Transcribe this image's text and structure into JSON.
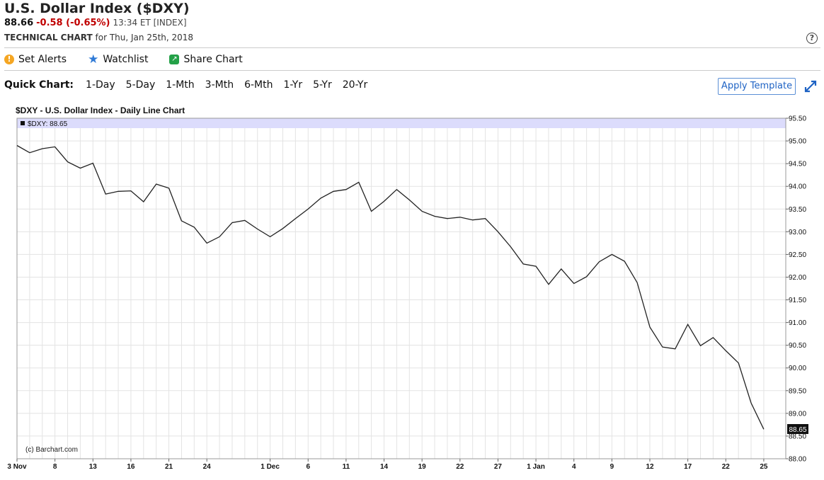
{
  "header": {
    "title": "U.S. Dollar Index ($DXY)",
    "last": "88.66",
    "change": "-0.58 (-0.65%)",
    "time": "13:34 ET [INDEX]",
    "chart_kind": "TECHNICAL CHART",
    "chart_date": "for Thu, Jan 25th, 2018",
    "help": "?"
  },
  "toolbar": {
    "alerts": "Set Alerts",
    "watchlist": "Watchlist",
    "share": "Share Chart",
    "alerts_icon": "!",
    "share_icon": "↗"
  },
  "quick": {
    "label": "Quick Chart:",
    "periods": [
      "1-Day",
      "5-Day",
      "1-Mth",
      "3-Mth",
      "6-Mth",
      "1-Yr",
      "5-Yr",
      "20-Yr"
    ],
    "apply": "Apply Template"
  },
  "chart_data": {
    "type": "line",
    "title": "$DXY - U.S. Dollar Index - Daily Line Chart",
    "legend": "$DXY: 88.65",
    "last_label": "88.65",
    "watermark": "(c) Barchart.com",
    "ylim": [
      88.0,
      95.5
    ],
    "y_ticks": [
      "88.00",
      "88.50",
      "89.00",
      "89.50",
      "90.00",
      "90.50",
      "91.00",
      "91.50",
      "92.00",
      "92.50",
      "93.00",
      "93.50",
      "94.00",
      "94.50",
      "95.00",
      "95.50"
    ],
    "x_labels": [
      {
        "i": 0,
        "t": "3 Nov"
      },
      {
        "i": 3,
        "t": "8"
      },
      {
        "i": 6,
        "t": "13"
      },
      {
        "i": 9,
        "t": "16"
      },
      {
        "i": 12,
        "t": "21"
      },
      {
        "i": 15,
        "t": "24"
      },
      {
        "i": 20,
        "t": "1 Dec"
      },
      {
        "i": 23,
        "t": "6"
      },
      {
        "i": 26,
        "t": "11"
      },
      {
        "i": 29,
        "t": "14"
      },
      {
        "i": 32,
        "t": "19"
      },
      {
        "i": 35,
        "t": "22"
      },
      {
        "i": 38,
        "t": "27"
      },
      {
        "i": 41,
        "t": "1 Jan"
      },
      {
        "i": 44,
        "t": "4"
      },
      {
        "i": 47,
        "t": "9"
      },
      {
        "i": 50,
        "t": "12"
      },
      {
        "i": 53,
        "t": "17"
      },
      {
        "i": 56,
        "t": "22"
      },
      {
        "i": 59,
        "t": "25"
      }
    ],
    "values": [
      94.9,
      94.74,
      94.83,
      94.87,
      94.54,
      94.4,
      94.51,
      93.83,
      93.89,
      93.9,
      93.66,
      94.05,
      93.96,
      93.24,
      93.1,
      92.75,
      92.89,
      93.2,
      93.25,
      93.06,
      92.89,
      93.07,
      93.29,
      93.5,
      93.74,
      93.89,
      93.93,
      94.09,
      93.45,
      93.67,
      93.93,
      93.7,
      93.45,
      93.34,
      93.29,
      93.32,
      93.26,
      93.29,
      93.0,
      92.67,
      92.29,
      92.24,
      91.84,
      92.18,
      91.86,
      92.01,
      92.34,
      92.5,
      92.35,
      91.88,
      90.9,
      90.46,
      90.42,
      90.96,
      90.49,
      90.67,
      90.38,
      90.11,
      89.23,
      88.65
    ]
  }
}
